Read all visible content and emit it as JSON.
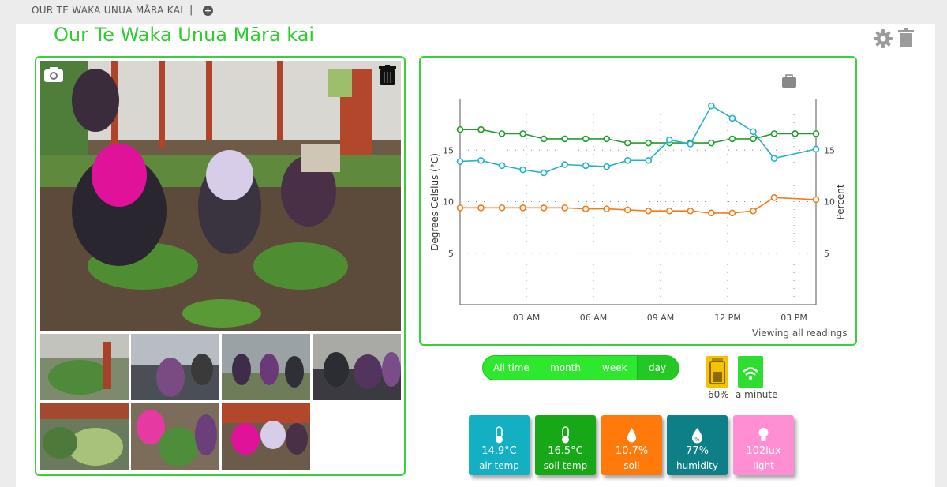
{
  "breadcrumb": {
    "label": "OUR TE WAKA UNUA MĀRA KAI",
    "separator": "|"
  },
  "page": {
    "title": "Our Te Waka Unua Māra kai"
  },
  "chart_footer": "Viewing all readings",
  "range_tabs": [
    "All time",
    "month",
    "week",
    "day"
  ],
  "active_range": "day",
  "device": {
    "battery": "60%",
    "last_seen": "a minute"
  },
  "tiles": [
    {
      "value": "14.9°C",
      "label": "air temp",
      "color": "#12b0c2",
      "icon": "thermometer-icon"
    },
    {
      "value": "16.5°C",
      "label": "soil temp",
      "color": "#16a816",
      "icon": "thermometer-icon"
    },
    {
      "value": "10.7%",
      "label": "soil",
      "color": "#ff7a0a",
      "icon": "droplet-icon"
    },
    {
      "value": "77%",
      "label": "humidity",
      "color": "#0d7f86",
      "icon": "humidity-icon"
    },
    {
      "value": "102lux",
      "label": "light",
      "color": "#ff8fd2",
      "icon": "bulb-icon"
    }
  ],
  "chart_data": {
    "type": "line",
    "xlabel": "",
    "ylabel": "Degrees Celsius (°C)",
    "y2label": "Percent",
    "x_ticks": [
      "03 AM",
      "06 AM",
      "09 AM",
      "12 PM",
      "03 PM"
    ],
    "y_ticks": [
      5,
      10,
      15
    ],
    "y2_ticks": [
      5,
      10,
      15
    ],
    "ylim": [
      0,
      20
    ],
    "grid": true,
    "series": [
      {
        "color": "#1e9e2a",
        "values": [
          17.0,
          17.0,
          16.6,
          16.6,
          16.1,
          16.1,
          16.1,
          16.1,
          15.7,
          15.7,
          15.7,
          15.7,
          15.7,
          16.1,
          16.1,
          16.6,
          16.6,
          16.6
        ]
      },
      {
        "color": "#22b3c8",
        "values": [
          13.9,
          14.0,
          13.5,
          13.1,
          12.8,
          13.6,
          13.5,
          13.4,
          14.0,
          14.0,
          16.0,
          15.6,
          19.3,
          18.1,
          16.8,
          14.2,
          15.1
        ]
      },
      {
        "color": "#f47b16",
        "values": [
          9.4,
          9.4,
          9.4,
          9.4,
          9.4,
          9.4,
          9.3,
          9.3,
          9.2,
          9.1,
          9.1,
          9.1,
          8.9,
          8.9,
          9.1,
          10.4,
          10.2
        ]
      }
    ]
  }
}
